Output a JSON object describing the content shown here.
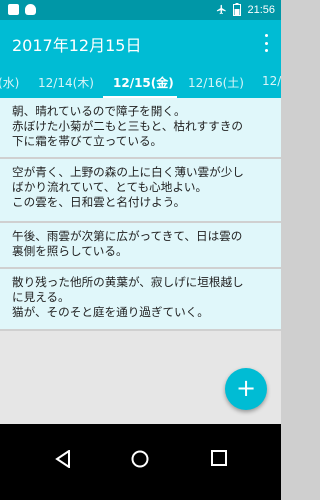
{
  "status_bar": {
    "time": "21:56",
    "left_icons": [
      "notification-icon",
      "cat-icon"
    ],
    "right_icons": [
      "airplane-icon",
      "battery-icon"
    ]
  },
  "app_bar": {
    "title": "2017年12月15日",
    "menu_icon": "more-vert-icon"
  },
  "tabs": [
    {
      "label": "(水)"
    },
    {
      "label": "12/14(木)"
    },
    {
      "label": "12/15(金)",
      "active": true
    },
    {
      "label": "12/16(土)"
    },
    {
      "label": "12/"
    }
  ],
  "cards": [
    {
      "text": "朝、晴れているので障子を開く。\n赤ぼけた小菊が二もと三もと、枯れすすきの\n下に霜を帯びて立っている。"
    },
    {
      "text": "空が青く、上野の森の上に白く薄い雲が少し\nばかり流れていて、とても心地よい。\nこの雲を、日和雲と名付けよう。"
    },
    {
      "text": "午後、雨雲が次第に広がってきて、日は雲の\n裏側を照らしている。"
    },
    {
      "text": "散り残った他所の黄葉が、寂しげに垣根越し\nに見える。\n猫が、そのそと庭を通り過ぎていく。"
    }
  ],
  "fab": {
    "label": "+"
  },
  "colors": {
    "primary": "#00bcd4",
    "primary_dark": "#0097a7",
    "card_bg": "#e0f7fa"
  }
}
